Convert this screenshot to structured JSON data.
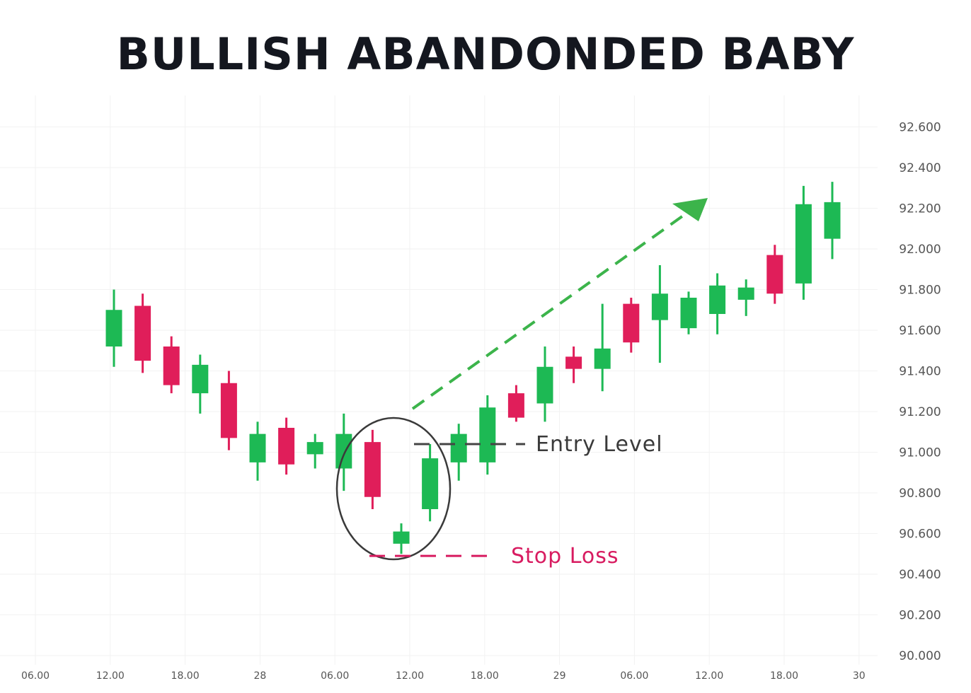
{
  "chart_data": {
    "type": "candlestick",
    "title": "BULLISH ABANDONDED BABY",
    "y_ticks": [
      "90.000",
      "90.200",
      "90.400",
      "90.600",
      "90.800",
      "91.000",
      "91.200",
      "91.400",
      "91.600",
      "91.800",
      "92.000",
      "92.200",
      "92.400",
      "92.600"
    ],
    "y_tick_values": [
      90.0,
      90.2,
      90.4,
      90.6,
      90.8,
      91.0,
      91.2,
      91.4,
      91.6,
      91.8,
      92.0,
      92.2,
      92.4,
      92.6
    ],
    "ylim": [
      90.0,
      92.6
    ],
    "x_ticks": [
      "06.00",
      "12.00",
      "18.00",
      "28",
      "06.00",
      "12.00",
      "18.00",
      "29",
      "06.00",
      "12.00",
      "18.00",
      "30"
    ],
    "grid": true,
    "colors": {
      "up": "#1db954",
      "down": "#e01e5a",
      "arrow": "#3cb44b",
      "text": "#14171f",
      "entry": "#444444",
      "stop": "#d81b60"
    },
    "candles": [
      {
        "open": 91.52,
        "high": 91.8,
        "low": 91.42,
        "close": 91.7
      },
      {
        "open": 91.72,
        "high": 91.78,
        "low": 91.39,
        "close": 91.45
      },
      {
        "open": 91.52,
        "high": 91.57,
        "low": 91.29,
        "close": 91.33
      },
      {
        "open": 91.29,
        "high": 91.48,
        "low": 91.19,
        "close": 91.43
      },
      {
        "open": 91.34,
        "high": 91.4,
        "low": 91.01,
        "close": 91.07
      },
      {
        "open": 90.95,
        "high": 91.15,
        "low": 90.86,
        "close": 91.09
      },
      {
        "open": 91.12,
        "high": 91.17,
        "low": 90.89,
        "close": 90.94
      },
      {
        "open": 90.99,
        "high": 91.09,
        "low": 90.92,
        "close": 91.05
      },
      {
        "open": 90.92,
        "high": 91.19,
        "low": 90.81,
        "close": 91.09
      },
      {
        "open": 91.05,
        "high": 91.11,
        "low": 90.72,
        "close": 90.78
      },
      {
        "open": 90.55,
        "high": 90.65,
        "low": 90.5,
        "close": 90.61
      },
      {
        "open": 90.72,
        "high": 91.04,
        "low": 90.66,
        "close": 90.97
      },
      {
        "open": 90.95,
        "high": 91.14,
        "low": 90.86,
        "close": 91.09
      },
      {
        "open": 90.95,
        "high": 91.28,
        "low": 90.89,
        "close": 91.22
      },
      {
        "open": 91.29,
        "high": 91.33,
        "low": 91.15,
        "close": 91.17
      },
      {
        "open": 91.24,
        "high": 91.52,
        "low": 91.15,
        "close": 91.42
      },
      {
        "open": 91.47,
        "high": 91.52,
        "low": 91.34,
        "close": 91.41
      },
      {
        "open": 91.41,
        "high": 91.73,
        "low": 91.3,
        "close": 91.51
      },
      {
        "open": 91.73,
        "high": 91.76,
        "low": 91.49,
        "close": 91.54
      },
      {
        "open": 91.65,
        "high": 91.92,
        "low": 91.44,
        "close": 91.78
      },
      {
        "open": 91.61,
        "high": 91.79,
        "low": 91.58,
        "close": 91.76
      },
      {
        "open": 91.68,
        "high": 91.88,
        "low": 91.58,
        "close": 91.82
      },
      {
        "open": 91.75,
        "high": 91.85,
        "low": 91.67,
        "close": 91.81
      },
      {
        "open": 91.97,
        "high": 92.02,
        "low": 91.73,
        "close": 91.78
      },
      {
        "open": 91.83,
        "high": 92.31,
        "low": 91.75,
        "close": 92.22
      },
      {
        "open": 92.05,
        "high": 92.33,
        "low": 91.95,
        "close": 92.23
      }
    ],
    "annotations": {
      "entry_label": "Entry Level",
      "entry_value": 91.04,
      "stop_label": "Stop Loss",
      "stop_value": 90.49
    }
  }
}
